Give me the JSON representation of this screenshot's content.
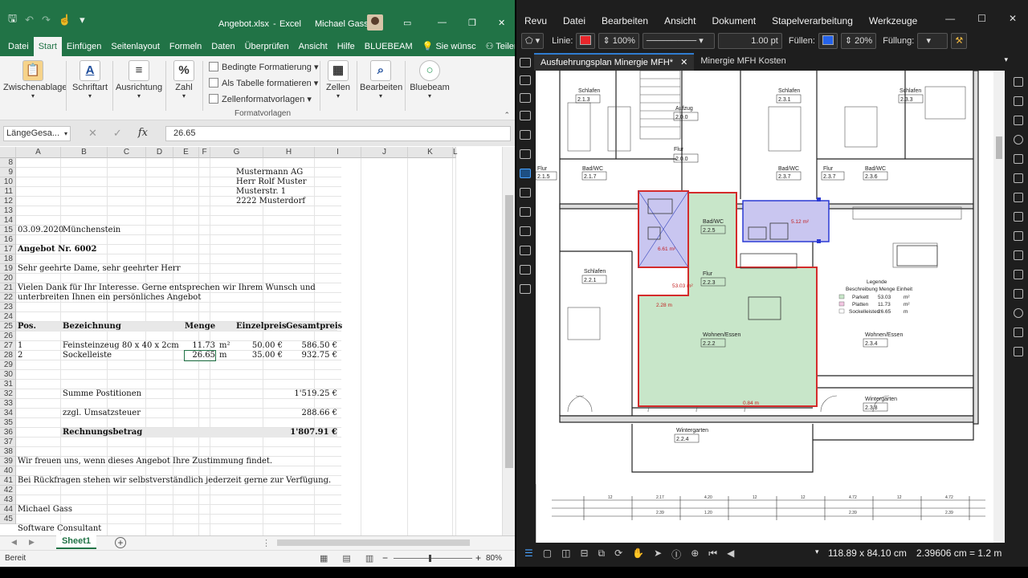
{
  "excel": {
    "filename": "Angebot.xlsx",
    "app": "Excel",
    "user": "Michael Gass",
    "tabs": [
      "Datei",
      "Start",
      "Einfügen",
      "Seitenlayout",
      "Formeln",
      "Daten",
      "Überprüfen",
      "Ansicht",
      "Hilfe",
      "BLUEBEAM",
      "Sie wünsc",
      "Teilen"
    ],
    "ribbon": {
      "zwischenablage": "Zwischenablage",
      "schriftart": "Schriftart",
      "ausrichtung": "Ausrichtung",
      "zahl": "Zahl",
      "bedingte": "Bedingte Formatierung",
      "tabelle": "Als Tabelle formatieren",
      "zellenformat": "Zellenformatvorlagen",
      "formatvorlagen": "Formatvorlagen",
      "zellen": "Zellen",
      "bearbeiten": "Bearbeiten",
      "bluebeam": "Bluebeam"
    },
    "namebox": "LängeGesa...",
    "formula": "26.65",
    "columns": [
      "A",
      "B",
      "C",
      "D",
      "E",
      "F",
      "G",
      "H",
      "I",
      "J",
      "K",
      "L"
    ],
    "rows": [
      "8",
      "9",
      "10",
      "11",
      "12",
      "13",
      "14",
      "15",
      "16",
      "17",
      "18",
      "19",
      "20",
      "21",
      "22",
      "23",
      "24",
      "25",
      "26",
      "27",
      "28",
      "29",
      "30",
      "31",
      "32",
      "33",
      "34",
      "35",
      "36",
      "37",
      "38",
      "39",
      "40",
      "41",
      "42",
      "43",
      "44",
      "45"
    ],
    "cells": {
      "addr1": "Mustermann AG",
      "addr2": "Herr Rolf Muster",
      "addr3": "Musterstr. 1",
      "addr4": "2222 Musterdorf",
      "date": "03.09.2020",
      "place": "Münchenstein",
      "offer": "Angebot Nr. 6002",
      "greeting": "Sehr geehrte Dame, sehr geehrter Herr",
      "thanks1": "Vielen Dank für Ihr Interesse. Gerne entsprechen wir Ihrem Wunsch und",
      "thanks2": "unterbreiten Ihnen ein persönliches Angebot",
      "h_pos": "Pos.",
      "h_bez": "Bezeichnung",
      "h_menge": "Menge",
      "h_ep": "Einzelpreis",
      "h_gp": "Gesamtpreis",
      "p1_pos": "1",
      "p1_bez": "Feinsteinzeug 80 x 40 x 2cm",
      "p1_menge": "11.73",
      "p1_unit": "m²",
      "p1_ep": "50.00 €",
      "p1_gp": "586.50 €",
      "p2_pos": "2",
      "p2_bez": "Sockelleiste",
      "p2_menge": "26.65",
      "p2_unit": "m",
      "p2_ep": "35.00 €",
      "p2_gp": "932.75 €",
      "sum_label": "Summe Postitionen",
      "sum_val": "1'519.25 €",
      "vat_label": "zzgl. Umsatzsteuer",
      "vat_val": "288.66 €",
      "total_label": "Rechnungsbetrag",
      "total_val": "1'807.91 €",
      "closing1": "Wir freuen uns, wenn dieses Angebot Ihre Zustimmung findet.",
      "closing2": "Bei Rückfragen stehen wir selbstverständlich jederzeit gerne zur Verfügung.",
      "sign_name": "Michael Gass",
      "sign_title": "Software Consultant"
    },
    "sheet": "Sheet1",
    "status": "Bereit",
    "zoom": "80%"
  },
  "revu": {
    "menu": [
      "Revu",
      "Datei",
      "Bearbeiten",
      "Ansicht",
      "Dokument",
      "Stapelverarbeitung",
      "Werkzeuge"
    ],
    "toolbar": {
      "linie": "Linie:",
      "linie_color": "#e8262b",
      "opacity": "100%",
      "width": "1.00 pt",
      "fuellen": "Füllen:",
      "fill_color": "#2563eb",
      "fill_opacity": "20%",
      "fuellung": "Füllung:"
    },
    "doctabs": [
      "Ausfuehrungsplan Minergie MFH*",
      "Minergie MFH Kosten"
    ],
    "plan": {
      "rooms": [
        {
          "name": "Schlafen",
          "id": "2.1.3"
        },
        {
          "name": "Aufzug",
          "id": "2.0.0"
        },
        {
          "name": "Schlafen",
          "id": "2.3.1"
        },
        {
          "name": "Schlafen",
          "id": "2.3.3"
        },
        {
          "name": "Flur",
          "id": "2.0.0"
        },
        {
          "name": "Flur",
          "id": "2.1.5"
        },
        {
          "name": "Bad/WC",
          "id": "2.1.7"
        },
        {
          "name": "Bad/WC",
          "id": "2.3.7"
        },
        {
          "name": "Flur",
          "id": "2.3.7"
        },
        {
          "name": "Bad/WC",
          "id": "2.3.6"
        },
        {
          "name": "Bad/WC",
          "id": "2.2.5"
        },
        {
          "name": "Schlafen",
          "id": "2.2.1"
        },
        {
          "name": "Flur",
          "id": "2.2.3"
        },
        {
          "name": "Wohnen/Essen",
          "id": "2.2.2"
        },
        {
          "name": "Wohnen/Essen",
          "id": "2.3.4"
        },
        {
          "name": "Wintergarten",
          "id": "2.3.8"
        },
        {
          "name": "Wintergarten",
          "id": "2.2.4"
        }
      ],
      "measures": [
        "6.61 m²",
        "53.03 m²",
        "2.28 m",
        "5.12 m²",
        "0.84 m"
      ],
      "legend": {
        "title": "Legende",
        "header": "Beschreibung  Menge  Einheit",
        "items": [
          {
            "label": "Parkett",
            "qty": "53.03",
            "unit": "m²",
            "color": "#c8e6c9"
          },
          {
            "label": "Platten",
            "qty": "11.73",
            "unit": "m²",
            "color": "#f3c7e3"
          },
          {
            "label": "Sockelleisten",
            "qty": "26.65",
            "unit": "m",
            "color": "#ffffff"
          }
        ]
      }
    },
    "status": {
      "dims": "118.89 x 84.10 cm",
      "scale": "2.39606 cm = 1.2 m"
    }
  }
}
